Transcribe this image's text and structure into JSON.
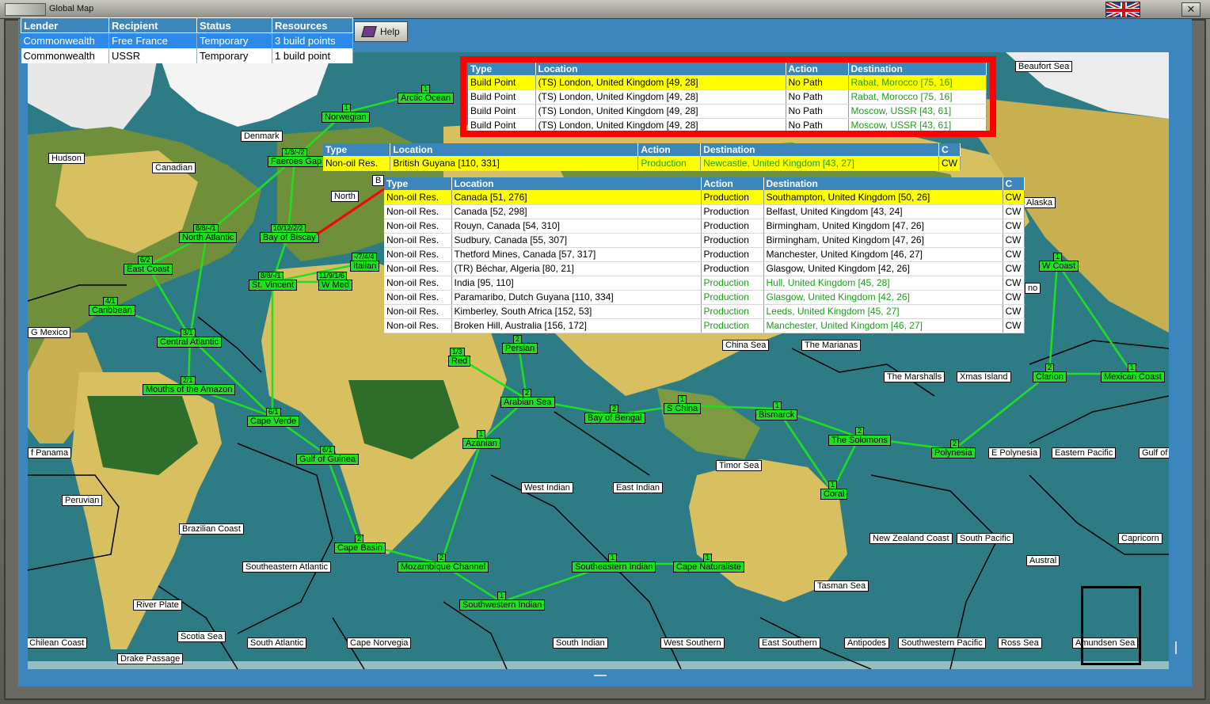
{
  "window": {
    "title": "Global Map",
    "close": "✕"
  },
  "help_label": "Help",
  "lender_table": {
    "headers": [
      "Lender",
      "Recipient",
      "Status",
      "Resources"
    ],
    "rows": [
      [
        "Commonwealth",
        "Free France",
        "Temporary",
        "3 build points"
      ],
      [
        "Commonwealth",
        "USSR",
        "Temporary",
        "1 build point"
      ]
    ]
  },
  "table1": {
    "headers": [
      "Type",
      "Location",
      "Action",
      "Destination"
    ],
    "rows": [
      [
        "Build Point",
        "(TS) London, United Kingdom [49, 28]",
        "No Path",
        "Rabat, Morocco [75, 16]"
      ],
      [
        "Build Point",
        "(TS) London, United Kingdom [49, 28]",
        "No Path",
        "Rabat, Morocco [75, 16]"
      ],
      [
        "Build Point",
        "(TS) London, United Kingdom [49, 28]",
        "No Path",
        "Moscow, USSR [43, 61]"
      ],
      [
        "Build Point",
        "(TS) London, United Kingdom [49, 28]",
        "No Path",
        "Moscow, USSR [43, 61]"
      ]
    ]
  },
  "table2": {
    "headers": [
      "Type",
      "Location",
      "Action",
      "Destination",
      "C"
    ],
    "rows": [
      [
        "Non-oil Res.",
        "British Guyana [110, 331]",
        "Production",
        "Newcastle, United Kingdom [43, 27]",
        "CW"
      ]
    ]
  },
  "table3": {
    "headers": [
      "Type",
      "Location",
      "Action",
      "Destination",
      "C"
    ],
    "rows": [
      [
        "Non-oil Res.",
        "Canada [51, 276]",
        "Production",
        "Southampton, United Kingdom [50, 26]",
        "CW"
      ],
      [
        "Non-oil Res.",
        "Canada [52, 298]",
        "Production",
        "Belfast, United Kingdom [43, 24]",
        "CW"
      ],
      [
        "Non-oil Res.",
        "Rouyn, Canada [54, 310]",
        "Production",
        "Birmingham, United Kingdom [47, 26]",
        "CW"
      ],
      [
        "Non-oil Res.",
        "Sudbury, Canada [55, 307]",
        "Production",
        "Birmingham, United Kingdom [47, 26]",
        "CW"
      ],
      [
        "Non-oil Res.",
        "Thetford Mines, Canada [57, 317]",
        "Production",
        "Manchester, United Kingdom [46, 27]",
        "CW"
      ],
      [
        "Non-oil Res.",
        "(TR) Béchar, Algeria [80, 21]",
        "Production",
        "Glasgow, United Kingdom [42, 26]",
        "CW"
      ],
      [
        "Non-oil Res.",
        "India [95, 110]",
        "Production",
        "Hull, United Kingdom [45, 28]",
        "CW"
      ],
      [
        "Non-oil Res.",
        "Paramaribo, Dutch Guyana [110, 334]",
        "Production",
        "Glasgow, United Kingdom [42, 26]",
        "CW"
      ],
      [
        "Non-oil Res.",
        "Kimberley, South Africa [152, 53]",
        "Production",
        "Leeds, United Kingdom [45, 27]",
        "CW"
      ],
      [
        "Non-oil Res.",
        "Broken Hill, Australia [156, 172]",
        "Production",
        "Manchester, United Kingdom [46, 27]",
        "CW"
      ]
    ]
  },
  "sea_labels": [
    "Beaufort Sea",
    "Denmark",
    "Hudson",
    "Canadian",
    "North",
    "Alaska",
    "G Mexico",
    "China Sea",
    "The Marianas",
    "The Marshalls",
    "Xmas Island",
    "f Panama",
    "E Polynesia",
    "Eastern Pacific",
    "Gulf of",
    "Peruvian",
    "Timor Sea",
    "West Indian",
    "East Indian",
    "Brazilian Coast",
    "New Zealand Coast",
    "South Pacific",
    "Capricorn",
    "Southeastern Atlantic",
    "Austral",
    "Tasman Sea",
    "River Plate",
    "Scotia Sea",
    "Chilean Coast",
    "South Atlantic",
    "Cape Norvegia",
    "South Indian",
    "West Southern",
    "East Southern",
    "Antipodes",
    "Southwestern Pacific",
    "Ross Sea",
    "Amundsen Sea",
    "Drake Passage",
    "B",
    "no"
  ],
  "routes": [
    "Arctic Ocean",
    "Norwegian",
    "Faeroes Gap",
    "North Atlantic",
    "Bay of Biscay",
    "East Coast",
    "St. Vincent",
    "Italian",
    "W Med",
    "Caribbean",
    "Central Atlantic",
    "Mouths of the Amazon",
    "Cape Verde",
    "Gulf of Guinea",
    "Red",
    "Persian",
    "Arabian Sea",
    "Bay of Bengal",
    "S China",
    "Bismarck",
    "The Solomons",
    "Polynesia",
    "Clarion",
    "Mexican Coast",
    "W Coast",
    "Azanian",
    "Coral",
    "Cape Basin",
    "Mozambique Channel",
    "Southeastern Indian",
    "Cape Naturaliste",
    "Southwestern Indian"
  ],
  "route_numbers": [
    "1",
    "1",
    "1/8/-/2",
    "8/8/-/1",
    "10/12/2/2",
    "6/2",
    "8/8/-/1",
    "11/9/1/6",
    "-/7/4/4",
    "4/1",
    "3/1",
    "2/1",
    "6/1",
    "6/1",
    "1/3",
    "2",
    "2",
    "2",
    "1",
    "1",
    "2",
    "2",
    "2",
    "1",
    "1",
    "1",
    "1",
    "2",
    "2",
    "1",
    "1",
    "1"
  ]
}
